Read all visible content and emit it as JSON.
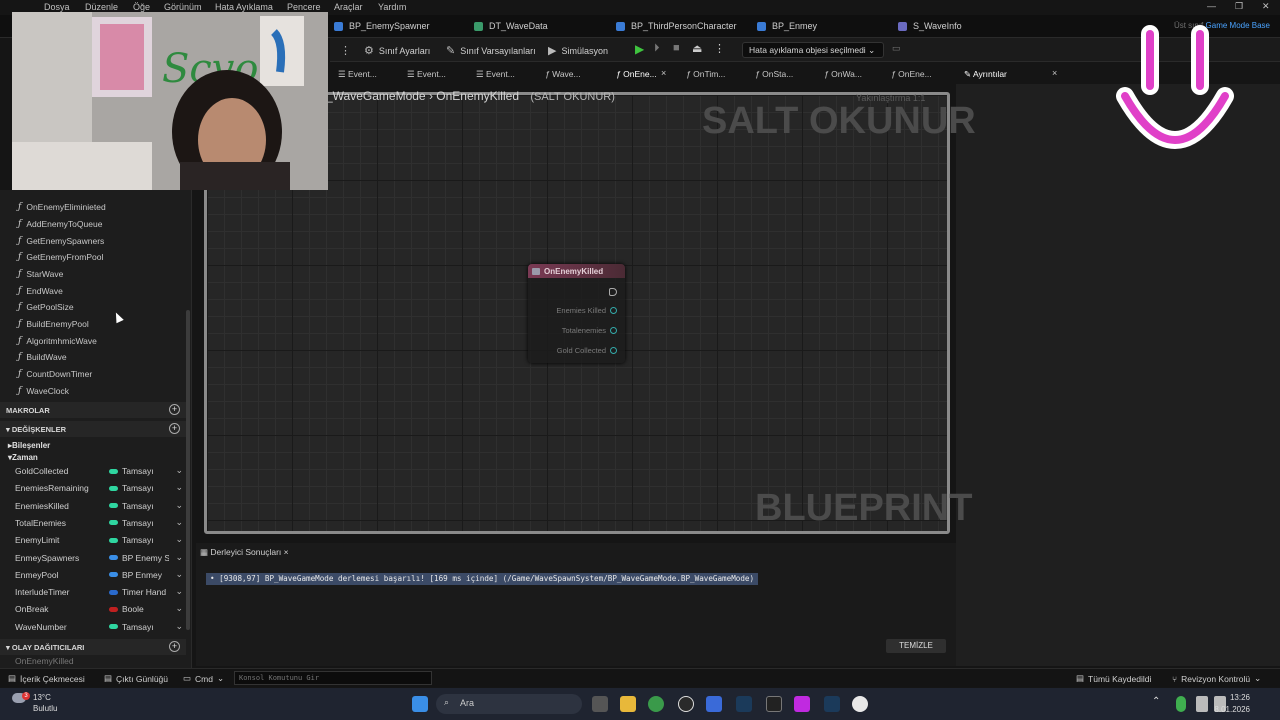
{
  "menu": {
    "items": [
      "Dosya",
      "Düzenle",
      "Öğe",
      "Görünüm",
      "Hata Ayıklama",
      "Pencere",
      "Araçlar",
      "Yardım"
    ]
  },
  "editor_tabs": [
    "BP_EnemySpawner",
    "DT_WaveData",
    "BP_ThirdPersonCharacter",
    "BP_Enmey",
    "S_WaveInfo"
  ],
  "parent_class": {
    "label": "Üst sınıf",
    "value": "Game Mode Base"
  },
  "toolbar": {
    "class_settings": "Sınıf Ayarları",
    "class_defaults": "Sınıf Varsayılanları",
    "simulation": "Simülasyon",
    "debug_object": "Hata ayıklama objesi seçilmedi"
  },
  "graph_tabs": [
    "Event...",
    "Event...",
    "Event...",
    "Wave...",
    "OnEne...",
    "OnTim...",
    "OnSta...",
    "OnWa...",
    "OnEne..."
  ],
  "details_tab": "Ayrıntılar",
  "breadcrumb": {
    "class": "_WaveGameMode",
    "function": "OnEnemyKilled",
    "readonly": "(SALT OKUNUR)"
  },
  "graph": {
    "watermark_top": "SALT OKUNUR",
    "watermark_bottom": "BLUEPRINT",
    "top_right_hint": "Yakınlaştırma 1:1"
  },
  "node": {
    "title": "OnEnemyKilled",
    "pins": [
      "Enemies Killed",
      "Totalenemies",
      "Gold Collected"
    ]
  },
  "functions": [
    "OnEnemyEliminieted",
    "AddEnemyToQueue",
    "GetEnemySpawners",
    "GetEnemyFromPool",
    "StarWave",
    "EndWave",
    "GetPoolSize",
    "BuildEnemyPool",
    "AlgoritmhmicWave",
    "BuildWave",
    "CountDownTimer",
    "WaveClock"
  ],
  "sections": {
    "macros": "MAKROLAR",
    "variables": "DEĞİŞKENLER",
    "dispatchers": "OLAY DAĞITICILARI"
  },
  "categories": {
    "components": "Bileşenler",
    "time": "Zaman"
  },
  "variables": [
    {
      "name": "GoldCollected",
      "type": "Tamsayı",
      "color": "#2fd6a0"
    },
    {
      "name": "EnemiesRemaining",
      "type": "Tamsayı",
      "color": "#2fd6a0"
    },
    {
      "name": "EnemiesKilled",
      "type": "Tamsayı",
      "color": "#2fd6a0"
    },
    {
      "name": "TotalEnemies",
      "type": "Tamsayı",
      "color": "#2fd6a0"
    },
    {
      "name": "EnemyLimit",
      "type": "Tamsayı",
      "color": "#2fd6a0"
    },
    {
      "name": "EnmeySpawners",
      "type": "BP Enemy S",
      "color": "#3a8ee6"
    },
    {
      "name": "EnmeyPool",
      "type": "BP Enmey",
      "color": "#3a8ee6"
    },
    {
      "name": "InterludeTimer",
      "type": "Timer Hand",
      "color": "#2a6acc"
    },
    {
      "name": "OnBreak",
      "type": "Boole",
      "color": "#c02020"
    },
    {
      "name": "WaveNumber",
      "type": "Tamsayı",
      "color": "#2fd6a0"
    }
  ],
  "dispatcher_partial": "OnEnemyKilled",
  "compiler": {
    "tab": "Derleyici Sonuçları",
    "message": "[9308,97] BP_WaveGameMode derlemesi başarılı! [169 ms içinde] (/Game/WaveSpawnSystem/BP_WaveGameMode.BP_WaveGameMode)",
    "clear": "TEMİZLE"
  },
  "statusbar": {
    "content_drawer": "İçerik Çekmecesi",
    "output_log": "Çıktı Günlüğü",
    "cmd": "Cmd",
    "console_placeholder": "Konsol Komutunu Gir",
    "save_all": "Tümü Kaydedildi",
    "revision": "Revizyon Kontrolü"
  },
  "taskbar": {
    "weather_temp": "13°C",
    "weather_desc": "Bulutlu",
    "weather_badge": "3",
    "search": "Ara",
    "time": "13:26",
    "date": "8.01.2026"
  },
  "colors": {
    "accent": "#4aa3ff",
    "smiley": "#e040c8",
    "node_header": "#7a3a54"
  }
}
